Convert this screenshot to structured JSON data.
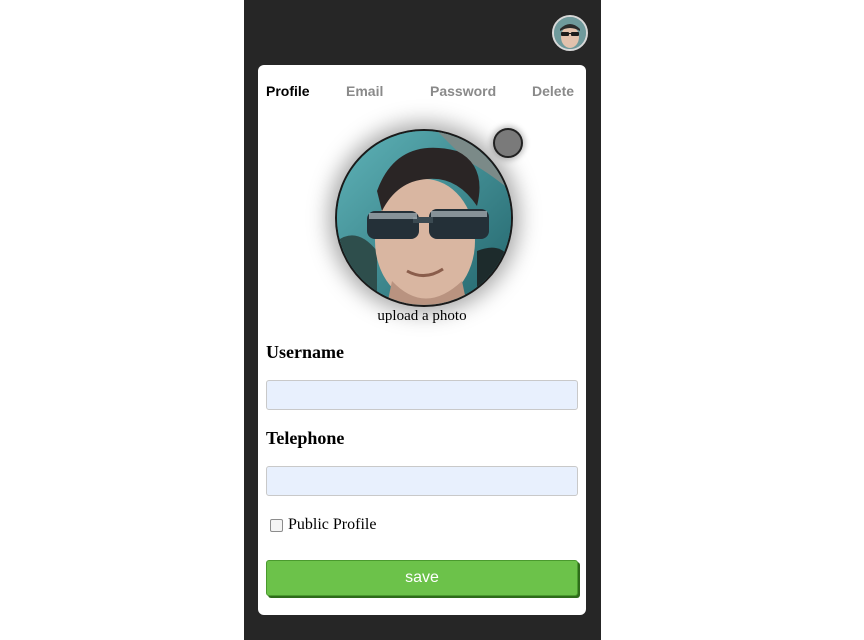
{
  "tabs": [
    {
      "label": "Profile",
      "active": true
    },
    {
      "label": "Email",
      "active": false
    },
    {
      "label": "Password",
      "active": false
    },
    {
      "label": "Delete",
      "active": false
    }
  ],
  "profile": {
    "upload_label": "upload a photo",
    "photo_icon": "user-photo",
    "edit_icon": "edit-photo-dot-icon"
  },
  "form": {
    "username_label": "Username",
    "username_value": "",
    "telephone_label": "Telephone",
    "telephone_value": "",
    "public_profile_label": "Public Profile",
    "public_profile_checked": false,
    "save_label": "save"
  },
  "colors": {
    "background": "#262626",
    "card": "#ffffff",
    "input_fill": "#e8f0fd",
    "save_button": "#6cc24a",
    "tab_active": "#000000",
    "tab_inactive": "#8a8a8a"
  }
}
